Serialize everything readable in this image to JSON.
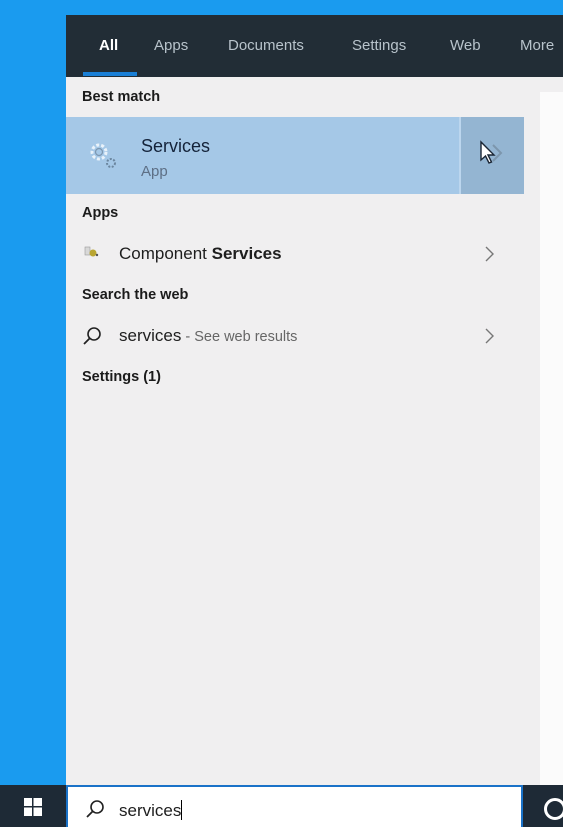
{
  "tabs": [
    {
      "label": "All",
      "active": true
    },
    {
      "label": "Apps",
      "active": false
    },
    {
      "label": "Documents",
      "active": false
    },
    {
      "label": "Settings",
      "active": false
    },
    {
      "label": "Web",
      "active": false
    },
    {
      "label": "More",
      "active": false
    }
  ],
  "best_match": {
    "header": "Best match",
    "title": "Services",
    "subtitle": "App",
    "icon": "gears-icon"
  },
  "apps": {
    "header": "Apps",
    "items": [
      {
        "label_prefix": "Component ",
        "label_bold": "Services",
        "icon": "component-services-icon"
      }
    ]
  },
  "web": {
    "header": "Search the web",
    "query": "services",
    "suffix": " - See web results",
    "icon": "search-icon"
  },
  "settings": {
    "header": "Settings (1)"
  },
  "taskbar": {
    "search_value": "services",
    "start_icon": "windows-logo-icon",
    "cortana_icon": "cortana-circle-icon"
  },
  "colors": {
    "accent": "#1a7fd6",
    "tab_bar": "#222d36",
    "selection": "#a5c8e7",
    "desktop": "#1a9bef"
  }
}
